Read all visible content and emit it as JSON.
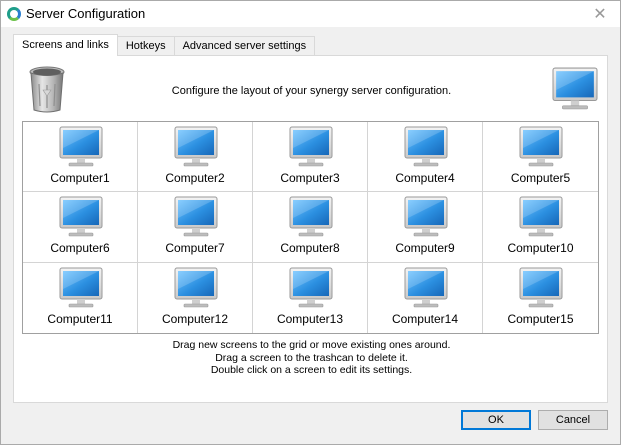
{
  "window": {
    "title": "Server Configuration"
  },
  "tabs": [
    {
      "label": "Screens and links"
    },
    {
      "label": "Hotkeys"
    },
    {
      "label": "Advanced server settings"
    }
  ],
  "panel": {
    "header": "Configure the layout of your synergy server configuration.",
    "trash_icon": "trashcan-icon",
    "new_screen_icon": "monitor-icon"
  },
  "grid": {
    "computers": [
      "Computer1",
      "Computer2",
      "Computer3",
      "Computer4",
      "Computer5",
      "Computer6",
      "Computer7",
      "Computer8",
      "Computer9",
      "Computer10",
      "Computer11",
      "Computer12",
      "Computer13",
      "Computer14",
      "Computer15"
    ]
  },
  "instructions": [
    "Drag new screens to the grid or move existing ones around.",
    "Drag a screen to the trashcan to delete it.",
    "Double click on a screen to edit its settings."
  ],
  "buttons": {
    "ok": "OK",
    "cancel": "Cancel"
  },
  "colors": {
    "accent": "#0078d7",
    "screen": "#2b8fe0"
  }
}
